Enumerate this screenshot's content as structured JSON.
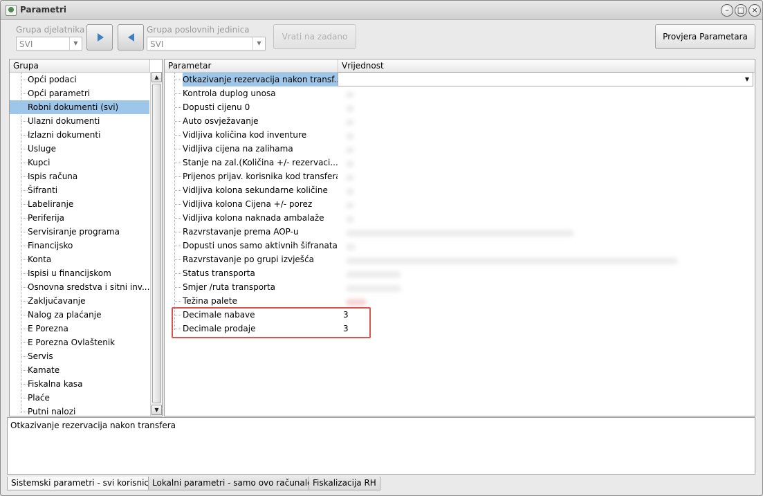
{
  "window": {
    "title": "Parametri"
  },
  "toolbar": {
    "grupa_djelatnika_label": "Grupa djelatnika",
    "grupa_djelatnika_value": "SVI",
    "grupa_poslovnih_label": "Grupa poslovnih jedinica",
    "grupa_poslovnih_value": "SVI",
    "reset_label": "Vrati na zadano",
    "check_label": "Provjera Parametara"
  },
  "groups": {
    "header": "Grupa",
    "selected_index": 2,
    "items": [
      "Opći podaci",
      "Opći parametri",
      "Robni dokumenti (svi)",
      "Ulazni dokumenti",
      "Izlazni dokumenti",
      "Usluge",
      "Kupci",
      "Ispis računa",
      "Šifranti",
      "Labeliranje",
      "Periferija",
      "Servisiranje programa",
      "Financijsko",
      "Konta",
      "Ispisi u financijskom",
      "Osnovna sredstva i sitni inv...",
      "Zaključavanje",
      "Nalog za plaćanje",
      "E Porezna",
      "E Porezna Ovlaštenik",
      "Servis",
      "Kamate",
      "Fiskalna kasa",
      "Plaće",
      "Putni nalozi"
    ]
  },
  "params": {
    "col_param": "Parametar",
    "col_value": "Vrijednost",
    "rows": [
      {
        "name": "Otkazivanje rezervacija nakon transf...",
        "value": ""
      },
      {
        "name": "Kontrola duplog unosa",
        "value": ""
      },
      {
        "name": "Dopusti cijenu 0",
        "value": ""
      },
      {
        "name": "Auto osvježavanje",
        "value": ""
      },
      {
        "name": "Vidljiva količina kod inventure",
        "value": ""
      },
      {
        "name": "Vidljiva cijena na zalihama",
        "value": ""
      },
      {
        "name": "Stanje na zal.(Količina +/- rezervaci...",
        "value": ""
      },
      {
        "name": "Prijenos prijav. korisnika kod transfera",
        "value": ""
      },
      {
        "name": "Vidljiva kolona sekundarne količine",
        "value": ""
      },
      {
        "name": "Vidljiva kolona Cijena +/- porez",
        "value": ""
      },
      {
        "name": "Vidljiva kolona naknada ambalaže",
        "value": ""
      },
      {
        "name": "Razvrstavanje prema AOP-u",
        "value": ""
      },
      {
        "name": "Dopusti unos samo aktivnih šifranata",
        "value": ""
      },
      {
        "name": "Razvrstavanje po grupi izvješća",
        "value": ""
      },
      {
        "name": "Status transporta",
        "value": ""
      },
      {
        "name": "Smjer /ruta transporta",
        "value": ""
      },
      {
        "name": "Težina palete",
        "value": ""
      },
      {
        "name": "Decimale nabave",
        "value": "3"
      },
      {
        "name": "Decimale prodaje",
        "value": "3"
      }
    ]
  },
  "description": "Otkazivanje rezervacija nakon transfera",
  "tabs": [
    "Sistemski parametri - svi korisnici",
    "Lokalni parametri - samo ovo računalo",
    "Fiskalizacija RH"
  ],
  "colors": {
    "selection": "#9ec6e8",
    "highlight_border": "#d9534f",
    "nav_arrow": "#3f7fc0"
  }
}
